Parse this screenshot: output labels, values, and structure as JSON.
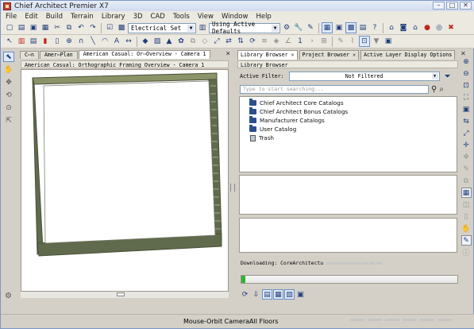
{
  "window": {
    "title": "Chief Architect Premier X7"
  },
  "menu": [
    "File",
    "Edit",
    "Build",
    "Terrain",
    "Library",
    "3D",
    "CAD",
    "Tools",
    "View",
    "Window",
    "Help"
  ],
  "toolbar": {
    "layer_set": "Electrical Set",
    "defaults_set": "Using Active Defaults",
    "zoom_value": "1"
  },
  "doc_tabs": [
    {
      "label": "C⋯n",
      "active": false
    },
    {
      "label": "Amer⋯Plan",
      "active": false
    },
    {
      "label": "American Casual: Or⋯Overview - Camera 1",
      "active": true
    }
  ],
  "view": {
    "title": "American Casual: Orthographic Framing Overview - Camera 1"
  },
  "panel_tabs": [
    {
      "label": "Library Browser",
      "active": true
    },
    {
      "label": "Project Browser",
      "active": false
    },
    {
      "label": "Active Layer Display Options",
      "active": false
    }
  ],
  "library": {
    "title": "Library Browser",
    "filter_label": "Active Filter:",
    "filter_value": "Not Filtered",
    "search_placeholder": "Type to start searching...",
    "items": [
      {
        "label": "Chief Architect Core Catalogs",
        "icon": "folder-icon"
      },
      {
        "label": "Chief Architect Bonus Catalogs",
        "icon": "folder-icon"
      },
      {
        "label": "Manufacturer Catalogs",
        "icon": "folder-icon"
      },
      {
        "label": "User Catalog",
        "icon": "folder-icon"
      },
      {
        "label": "Trash",
        "icon": "trash-icon"
      }
    ]
  },
  "download": {
    "label": "Downloading:",
    "item": "CoreArchitectu",
    "progress": 0.02
  },
  "status": {
    "mode": "Mouse-Orbit Camera",
    "floor": "All Floors"
  },
  "colors": {
    "wall": "#5f6b4c",
    "wall_top": "#8a9468",
    "frame": "#4a4f3b",
    "progress": "#2fb42f",
    "accent": "#1f3e7a"
  }
}
